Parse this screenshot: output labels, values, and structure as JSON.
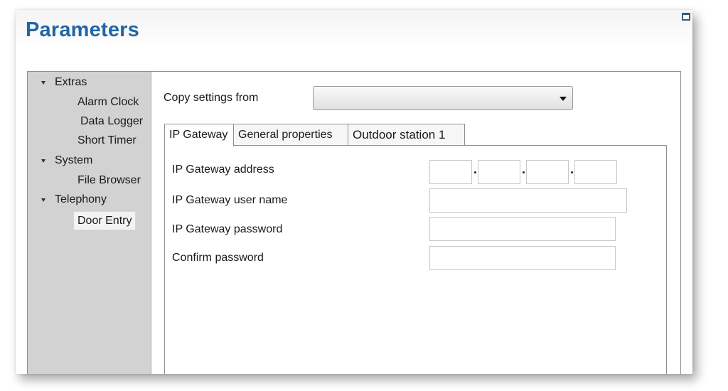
{
  "window": {
    "title": "Parameters"
  },
  "tree": {
    "items": [
      {
        "label": "Extras"
      },
      {
        "label": "Alarm Clock"
      },
      {
        "label": "Data Logger"
      },
      {
        "label": "Short Timer"
      },
      {
        "label": "System"
      },
      {
        "label": "File Browser"
      },
      {
        "label": "Telephony"
      },
      {
        "label": "Door Entry"
      }
    ],
    "selected": "Door Entry"
  },
  "copy_settings": {
    "label": "Copy settings from",
    "selected_value": ""
  },
  "tabs": [
    {
      "label": "IP Gateway",
      "active": true
    },
    {
      "label": "General properties",
      "active": false
    },
    {
      "label": "Outdoor station 1",
      "active": false
    }
  ],
  "fields": {
    "ip_address": {
      "label": "IP Gateway address",
      "octets": [
        "",
        "",
        "",
        ""
      ]
    },
    "user_name": {
      "label": "IP Gateway user name",
      "value": ""
    },
    "password": {
      "label": "IP Gateway password",
      "value": ""
    },
    "confirm_password": {
      "label": "Confirm password",
      "value": ""
    }
  },
  "colors": {
    "title": "#2166a6",
    "tree_background": "#d2d2d2"
  },
  "icons": {
    "corner": "window-restore-icon",
    "tree_expander": "triangle-down-icon",
    "dropdown": "chevron-down-icon"
  }
}
